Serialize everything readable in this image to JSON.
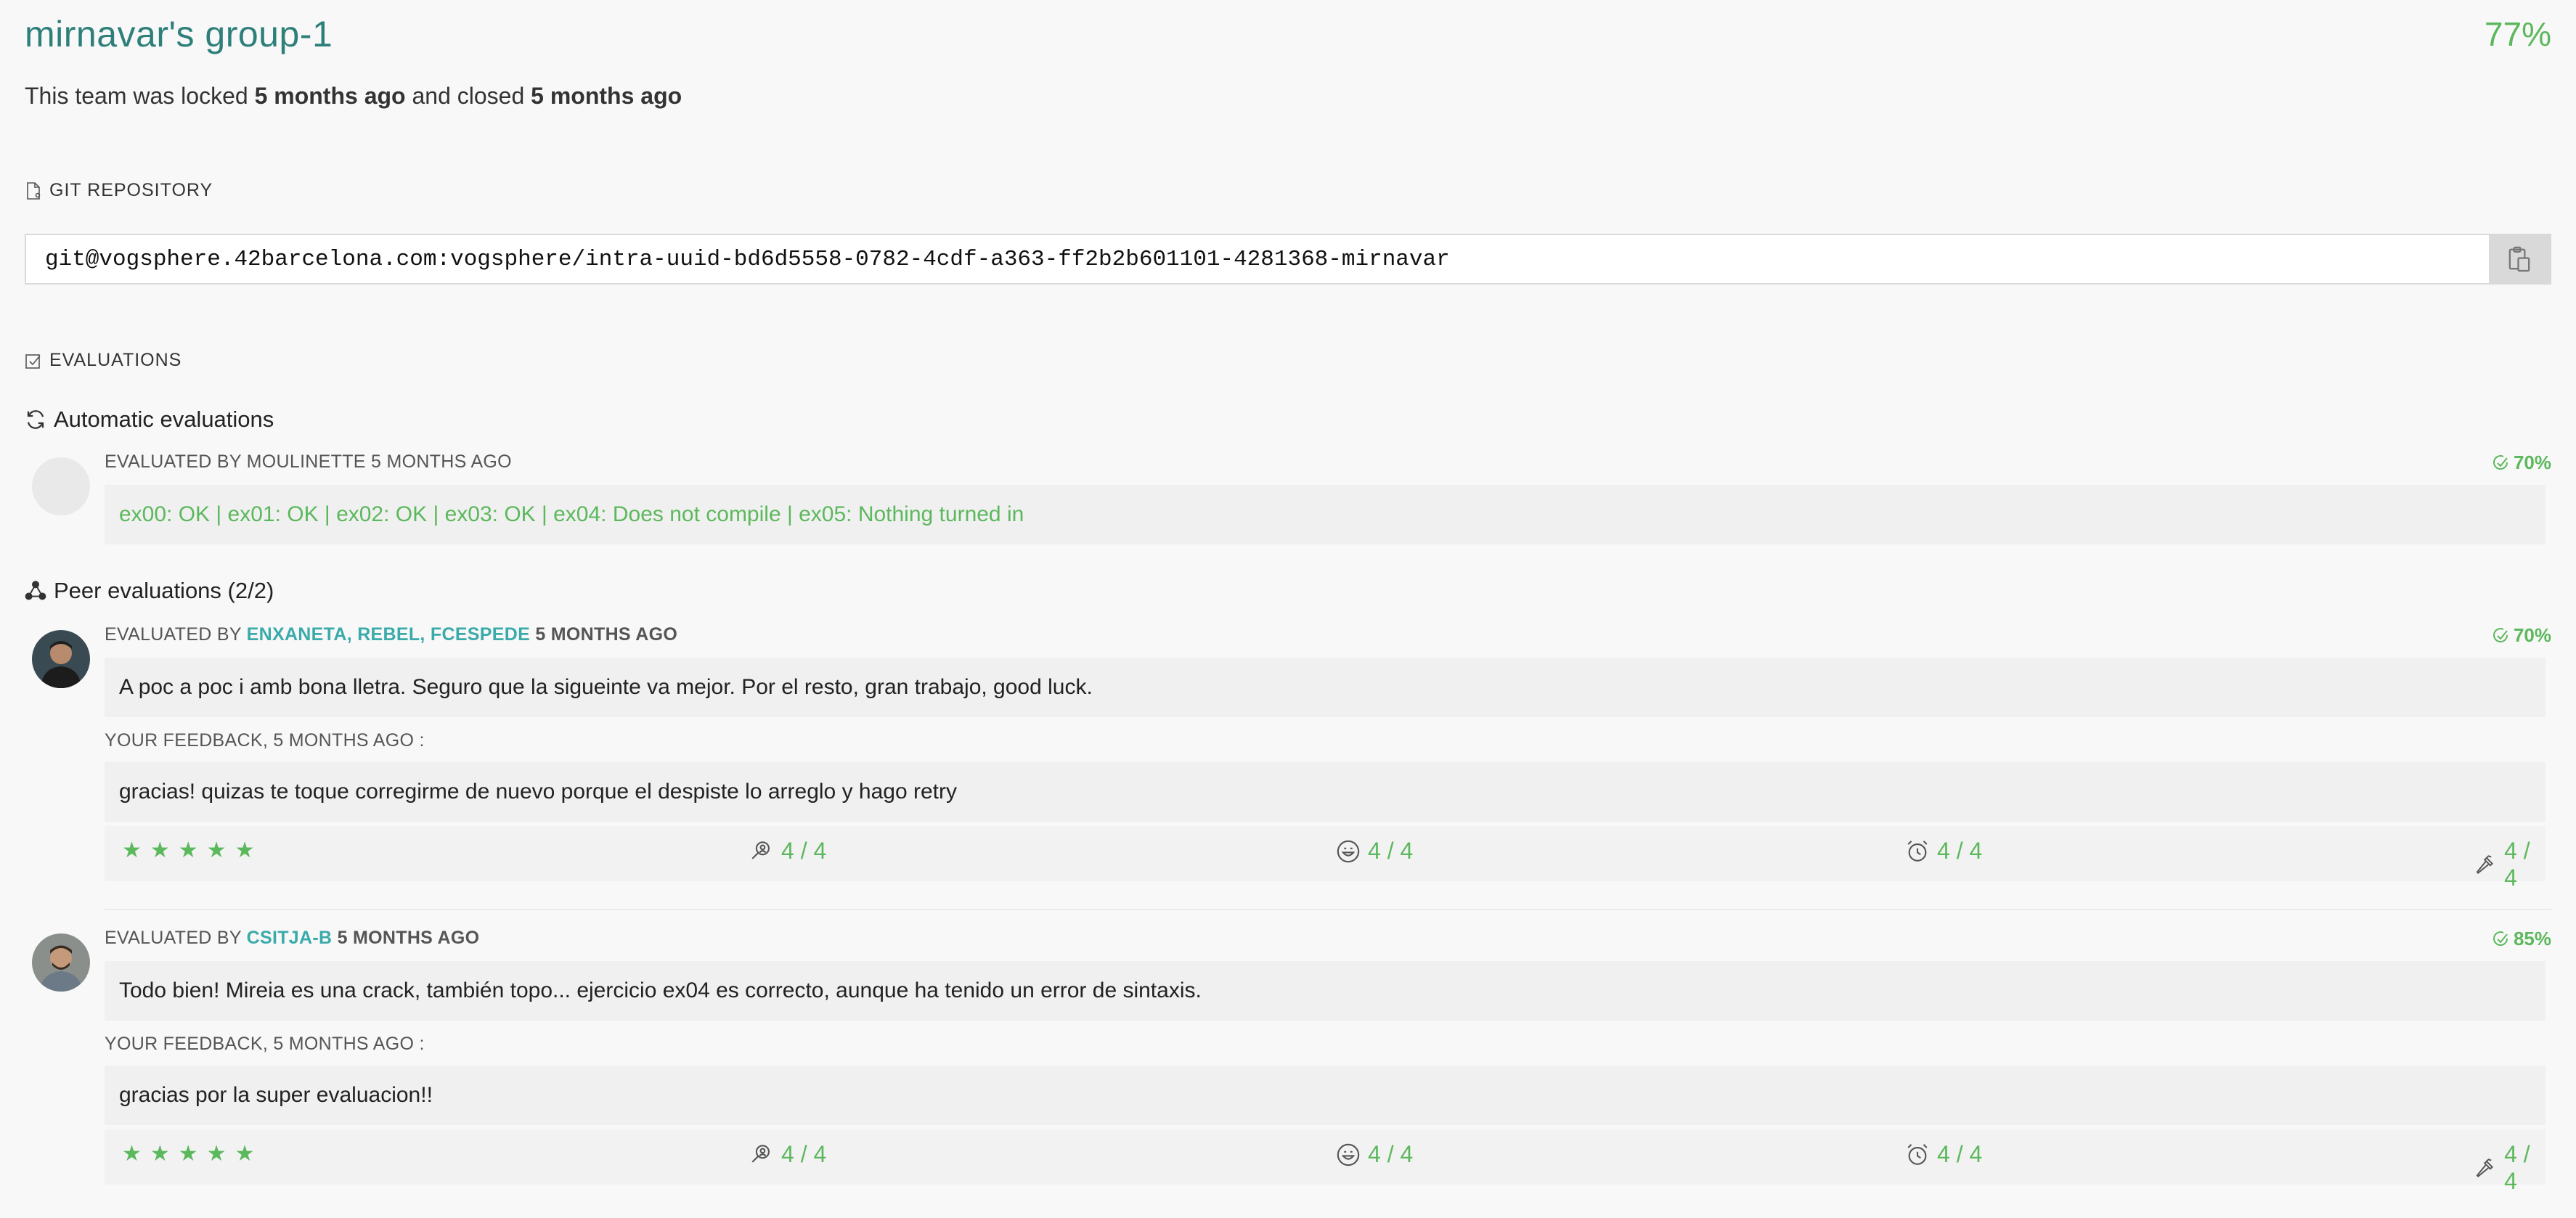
{
  "team": {
    "name": "mirnavar's group-1",
    "percent": "77%",
    "status_prefix": "This team was locked",
    "locked_ago": "5 months ago",
    "status_middle": "and closed",
    "closed_ago": "5 months ago"
  },
  "repository": {
    "title": "GIT REPOSITORY",
    "url": "git@vogsphere.42barcelona.com:vogsphere/intra-uuid-bd6d5558-0782-4cdf-a363-ff2b2b601101-4281368-mirnavar",
    "copy_icon": "clipboard-icon"
  },
  "evaluations": {
    "title": "EVALUATIONS",
    "automatic": {
      "title": "Automatic evaluations",
      "head": "EVALUATED BY MOULINETTE 5 MONTHS AGO",
      "percent": "70%",
      "result": "ex00: OK | ex01: OK | ex02: OK | ex03: OK | ex04: Does not compile | ex05: Nothing turned in"
    },
    "peer": {
      "title": "Peer evaluations (2/2)",
      "items": [
        {
          "prefix": "EVALUATED BY",
          "names": "ENXANETA, REBEL, FCESPEDE",
          "ago": "5 MONTHS AGO",
          "percent": "70%",
          "comment": "A poc a poc i amb bona lletra. Seguro que la sigueinte va mejor. Por el resto, gran trabajo, good luck.",
          "feedback_label": "YOUR FEEDBACK, 5 MONTHS AGO :",
          "feedback": "gracias! quizas te toque corregirme de nuevo porque el despiste lo arreglo y  hago retry",
          "stars": "★★★★★",
          "ratings": [
            "4 / 4",
            "4 / 4",
            "4 / 4",
            "4 / 4"
          ]
        },
        {
          "prefix": "EVALUATED BY",
          "names": "CSITJA-B",
          "ago": "5 MONTHS AGO",
          "percent": "85%",
          "comment": "Todo bien! Mireia es una crack, también topo... ejercicio ex04 es correcto, aunque ha tenido un error de sintaxis.",
          "feedback_label": "YOUR FEEDBACK, 5 MONTHS AGO :",
          "feedback": "gracias por la super evaluacion!!",
          "stars": "★★★★★",
          "ratings": [
            "4 / 4",
            "4 / 4",
            "4 / 4",
            "4 / 4"
          ]
        }
      ]
    }
  },
  "colors": {
    "accent_green": "#5cb85c",
    "title_teal": "#2e7f7a",
    "name_teal": "#3aaaaa"
  }
}
